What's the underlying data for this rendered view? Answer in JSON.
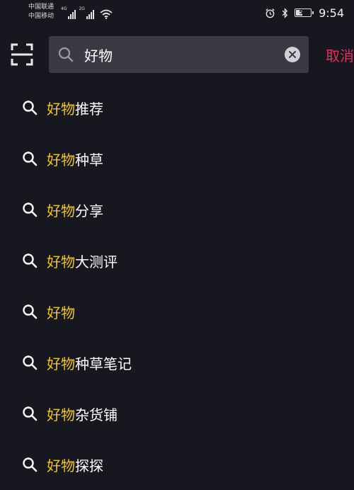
{
  "status_bar": {
    "carrier_1": "中国联通",
    "carrier_2": "中国移动",
    "net_tag_1": "4G",
    "net_tag_2": "2G",
    "battery": "50",
    "battery_level": 0.5,
    "time": "9:54"
  },
  "search": {
    "value": "好物",
    "cancel_label": "取消",
    "icons": {
      "scan": "scan-icon",
      "search": "search-icon",
      "clear": "clear-icon"
    }
  },
  "suggestions": [
    {
      "highlight": "好物",
      "rest": "推荐"
    },
    {
      "highlight": "好物",
      "rest": "种草"
    },
    {
      "highlight": "好物",
      "rest": "分享"
    },
    {
      "highlight": "好物",
      "rest": "大测评"
    },
    {
      "highlight": "好物",
      "rest": ""
    },
    {
      "highlight": "好物",
      "rest": "种草笔记"
    },
    {
      "highlight": "好物",
      "rest": "杂货铺"
    },
    {
      "highlight": "好物",
      "rest": "探探"
    }
  ],
  "colors": {
    "background": "#17171f",
    "search_box": "#3a3a44",
    "highlight": "#f5c51e",
    "cancel": "#e5315a",
    "text": "#ffffff"
  }
}
